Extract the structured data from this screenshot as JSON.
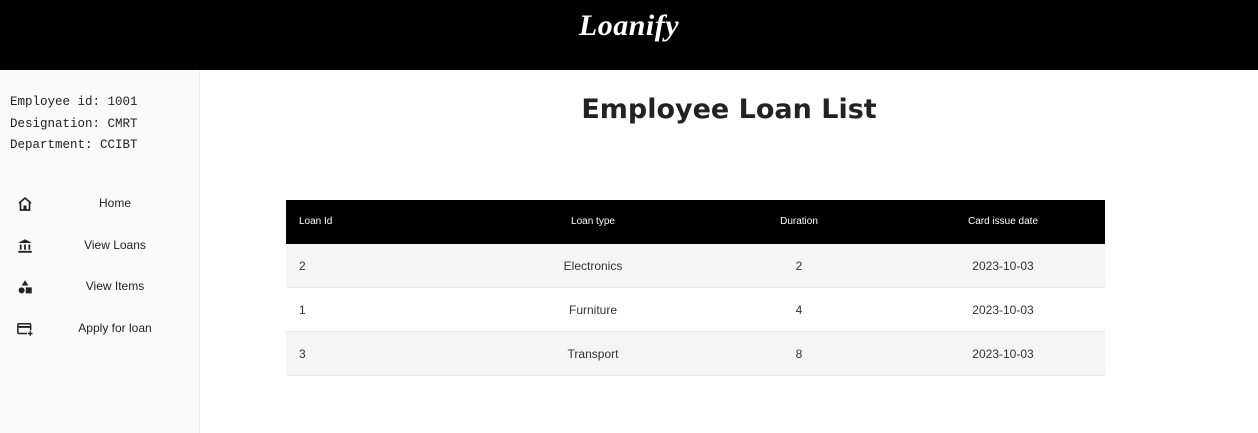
{
  "app": {
    "title": "Loanify"
  },
  "employee": {
    "id_line": "Employee id: 1001",
    "designation_line": "Designation: CMRT",
    "department_line": "Department: CCIBT"
  },
  "sidebar": {
    "items": [
      {
        "label": "Home",
        "icon": "home-icon"
      },
      {
        "label": "View Loans",
        "icon": "bank-icon"
      },
      {
        "label": "View Items",
        "icon": "shapes-icon"
      },
      {
        "label": "Apply for loan",
        "icon": "add-card-icon"
      }
    ]
  },
  "main": {
    "title": "Employee Loan List",
    "table": {
      "headers": [
        "Loan Id",
        "Loan type",
        "Duration",
        "Card issue date"
      ],
      "rows": [
        [
          "2",
          "Electronics",
          "2",
          "2023-10-03"
        ],
        [
          "1",
          "Furniture",
          "4",
          "2023-10-03"
        ],
        [
          "3",
          "Transport",
          "8",
          "2023-10-03"
        ]
      ]
    }
  },
  "colors": {
    "header_bg": "#000000",
    "sidebar_bg": "#fafafa",
    "row_alt": "#f5f5f5"
  }
}
